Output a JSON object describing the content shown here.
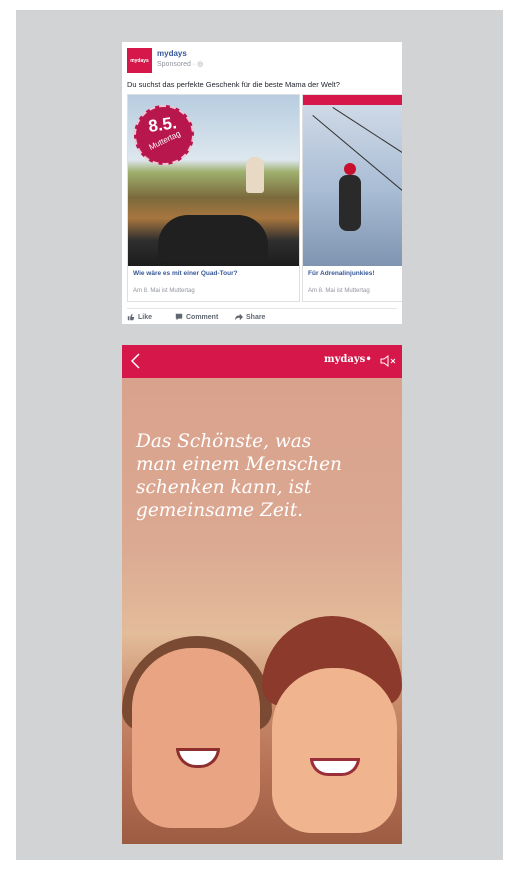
{
  "ad": {
    "page_name": "mydays",
    "logo_text": "mydays",
    "sponsored": "Sponsored · ",
    "text": "Du suchst das perfekte Geschenk für die beste Mama der Welt?",
    "cards": [
      {
        "badge_date": "8.5.",
        "badge_label": "Muttertag",
        "title": "Wie wäre es mit einer Quad-Tour?",
        "description": "Am 8. Mai ist Muttertag"
      },
      {
        "title": "Für Adrenalinjunkies!",
        "description": "Am 8. Mai ist Muttertag"
      }
    ],
    "actions": {
      "like": "Like",
      "comment": "Comment",
      "share": "Share"
    }
  },
  "story": {
    "brand": "mydays",
    "quote_lines": [
      "Das Schönste, was",
      "man einem Menschen",
      "schenken kann, ist",
      "gemeinsame Zeit."
    ]
  },
  "colors": {
    "brand": "#d6174a",
    "link": "#365899",
    "background": "#d1d3d4"
  }
}
